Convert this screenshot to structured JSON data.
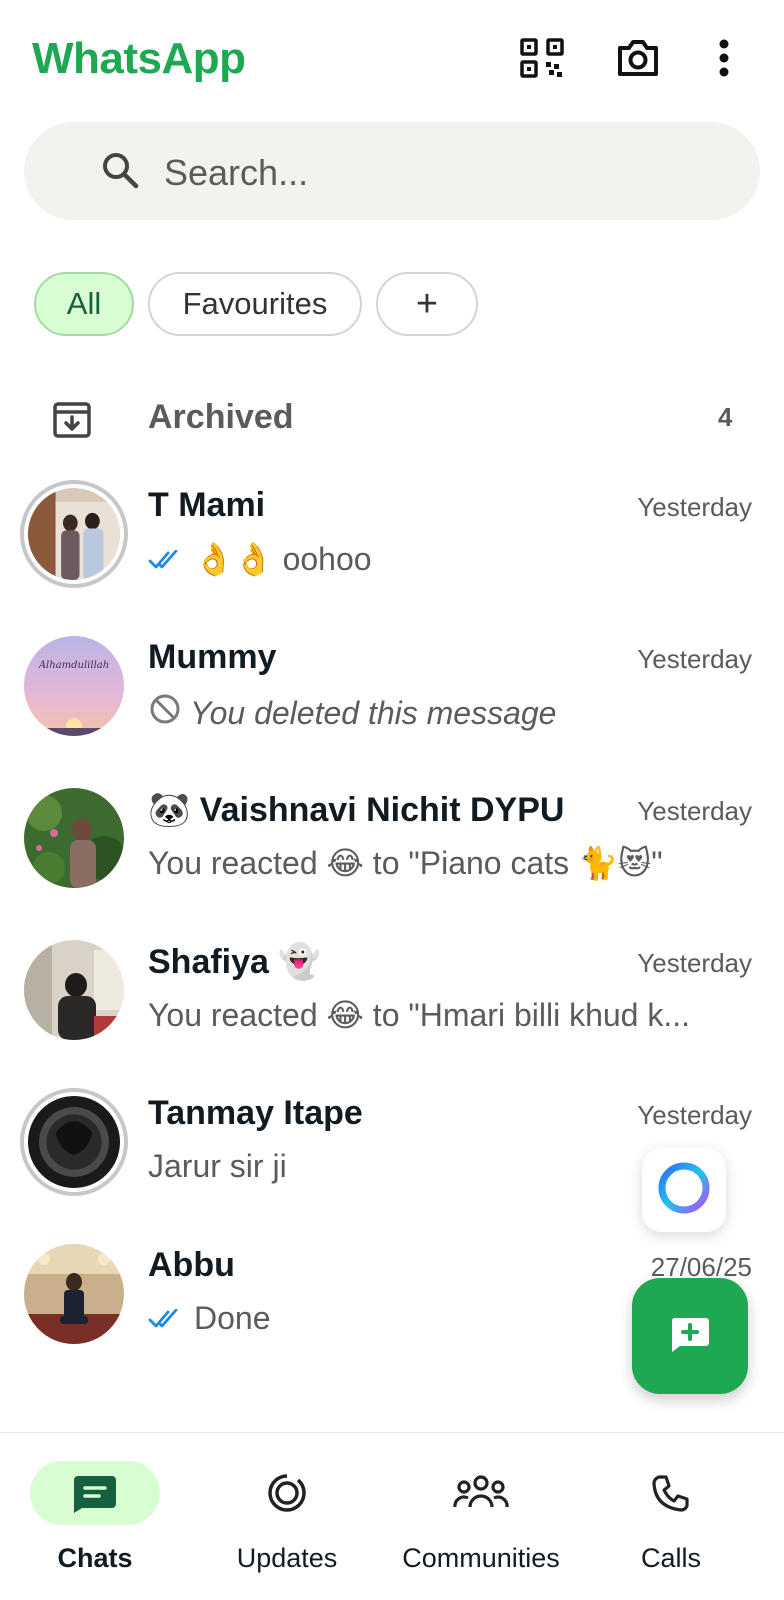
{
  "header": {
    "title": "WhatsApp",
    "icons": [
      "qr-code-icon",
      "camera-icon",
      "more-vert-icon"
    ]
  },
  "search": {
    "placeholder": "Search..."
  },
  "filters": [
    {
      "label": "All",
      "active": true
    },
    {
      "label": "Favourites",
      "active": false
    },
    {
      "label": "+",
      "active": false
    }
  ],
  "archived": {
    "label": "Archived",
    "count": "4"
  },
  "chats": [
    {
      "name": "T Mami",
      "time": "Yesterday",
      "ticks": true,
      "message": "👌👌 oohoo",
      "ring": true
    },
    {
      "name": "Mummy",
      "time": "Yesterday",
      "deleted": true,
      "message": "You deleted this message"
    },
    {
      "name": "🐼 Vaishnavi Nichit DYPU",
      "time": "Yesterday",
      "message": "You reacted 😂 to \"Piano cats 🐈😻\""
    },
    {
      "name": "Shafiya 👻",
      "time": "Yesterday",
      "message": "You reacted 😂 to \"Hmari billi khud k..."
    },
    {
      "name": "Tanmay Itape",
      "time": "Yesterday",
      "message": "Jarur sir ji",
      "ring": true
    },
    {
      "name": "Abbu",
      "time": "27/06/25",
      "ticks": true,
      "message": "Done"
    }
  ],
  "bottom_nav": [
    {
      "label": "Chats",
      "icon": "chats-icon",
      "active": true
    },
    {
      "label": "Updates",
      "icon": "updates-icon",
      "active": false
    },
    {
      "label": "Communities",
      "icon": "communities-icon",
      "active": false
    },
    {
      "label": "Calls",
      "icon": "calls-icon",
      "active": false
    }
  ],
  "colors": {
    "brand": "#1da851",
    "active_chip_bg": "#d9fdd3",
    "tick_blue": "#1e88e5"
  }
}
